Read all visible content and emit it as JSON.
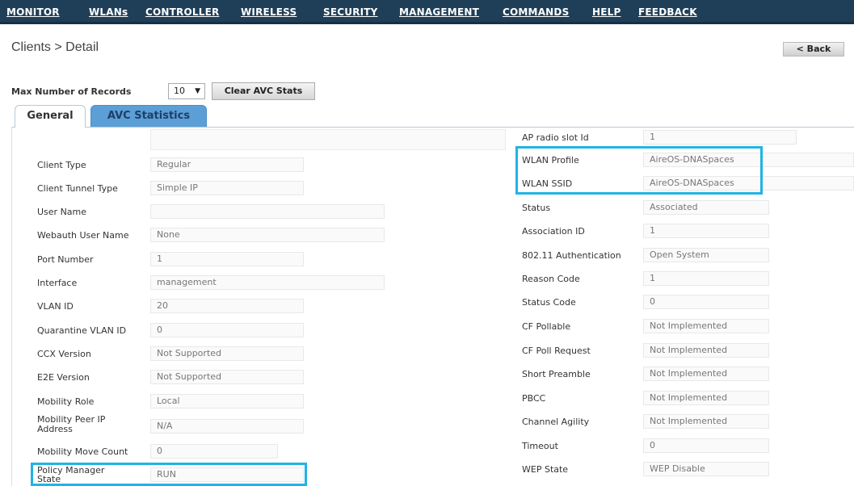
{
  "nav": {
    "items": [
      "MONITOR",
      "WLANs",
      "CONTROLLER",
      "WIRELESS",
      "SECURITY",
      "MANAGEMENT",
      "COMMANDS",
      "HELP",
      "FEEDBACK"
    ]
  },
  "breadcrumb": "Clients > Detail",
  "back_label": "< Back",
  "toolbar": {
    "max_records_label": "Max Number of Records",
    "max_records_value": "10",
    "clear_label": "Clear AVC Stats"
  },
  "tabs": [
    "General",
    "AVC Statistics"
  ],
  "left": [
    {
      "label": "Client Type",
      "value": "Regular"
    },
    {
      "label": "Client Tunnel Type",
      "value": "Simple IP"
    },
    {
      "label": "User Name",
      "value": ""
    },
    {
      "label": "Webauth User Name",
      "value": "None"
    },
    {
      "label": "Port Number",
      "value": "1"
    },
    {
      "label": "Interface",
      "value": "management"
    },
    {
      "label": "VLAN ID",
      "value": "20"
    },
    {
      "label": "Quarantine VLAN ID",
      "value": "0"
    },
    {
      "label": "CCX Version",
      "value": "Not Supported"
    },
    {
      "label": "E2E Version",
      "value": "Not Supported"
    },
    {
      "label": "Mobility Role",
      "value": "Local"
    },
    {
      "label": "Mobility Peer IP Address",
      "value": "N/A"
    },
    {
      "label": "Mobility Move Count",
      "value": "0"
    },
    {
      "label": "Policy Manager State",
      "value": "RUN"
    }
  ],
  "right": [
    {
      "label": "AP radio slot Id",
      "value": "1"
    },
    {
      "label": "WLAN Profile",
      "value": "AireOS-DNASpaces"
    },
    {
      "label": "WLAN SSID",
      "value": "AireOS-DNASpaces"
    },
    {
      "label": "Status",
      "value": "Associated"
    },
    {
      "label": "Association ID",
      "value": "1"
    },
    {
      "label": "802.11 Authentication",
      "value": "Open System"
    },
    {
      "label": "Reason Code",
      "value": "1"
    },
    {
      "label": "Status Code",
      "value": "0"
    },
    {
      "label": "CF Pollable",
      "value": "Not Implemented"
    },
    {
      "label": "CF Poll Request",
      "value": "Not Implemented"
    },
    {
      "label": "Short Preamble",
      "value": "Not Implemented"
    },
    {
      "label": "PBCC",
      "value": "Not Implemented"
    },
    {
      "label": "Channel Agility",
      "value": "Not Implemented"
    },
    {
      "label": "Timeout",
      "value": "0"
    },
    {
      "label": "WEP State",
      "value": "WEP Disable"
    }
  ],
  "colors": {
    "nav_bg": "#1f3f58",
    "tab_active": "#5b9fd6",
    "highlight": "#1fb4e6"
  }
}
